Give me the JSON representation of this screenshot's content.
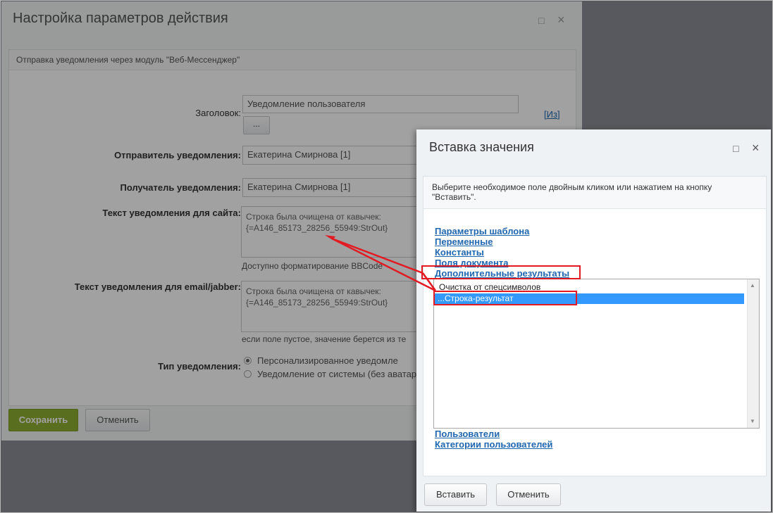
{
  "main_dialog": {
    "title": "Настройка параметров действия",
    "description": "Отправка уведомления через модуль \"Веб-Мессенджер\"",
    "fields": {
      "title_label": "Заголовок:",
      "title_value": "Уведомление пользователя",
      "title_more_button": "...",
      "side_link_bracket_open": "[",
      "side_link_text": "Из",
      "side_link_bracket_close": "]",
      "sender_label": "Отправитель уведомления:",
      "sender_value": "Екатерина Смирнова [1]",
      "recipient_label": "Получатель уведомления:",
      "recipient_value": "Екатерина Смирнова [1]",
      "site_text_label": "Текст уведомления для сайта:",
      "site_text_line1": "Строка была очищена от кавычек:",
      "site_text_line2": "{=A146_85173_28256_55949:StrOut}",
      "site_text_hint": "Доступно форматирование BBCode",
      "email_text_label": "Текст уведомления для email/jabber:",
      "email_text_line1": "Строка была очищена от кавычек:",
      "email_text_line2": "{=A146_85173_28256_55949:StrOut}",
      "email_text_hint": "если поле пустое, значение берется из те",
      "type_label": "Тип уведомления:",
      "type_option_personal": "Персонализированное уведомле",
      "type_option_system": "Уведомление от системы (без аватар"
    },
    "save_button": "Сохранить",
    "cancel_button": "Отменить"
  },
  "insert_dialog": {
    "title": "Вставка значения",
    "description": "Выберите необходимое поле двойным кликом или нажатием на кнопку \"Вставить\".",
    "tree_links": [
      "Параметры шаблона",
      "Переменные",
      "Константы",
      "Поля документа",
      "Дополнительные результаты"
    ],
    "list_items": [
      "Очистка от спецсимволов",
      "...Строка-результат"
    ],
    "selected_index": 1,
    "bottom_links": [
      "Пользователи",
      "Категории пользователей"
    ],
    "insert_button": "Вставить",
    "cancel_button": "Отменить"
  },
  "icons": {
    "maximize": "□",
    "close": "×",
    "scroll_up": "▲",
    "scroll_down": "▼"
  },
  "colors": {
    "annotation_red": "#e21a22",
    "selection_blue": "#3399ff",
    "link_blue": "#2067b0",
    "save_green": "#8eae32"
  }
}
